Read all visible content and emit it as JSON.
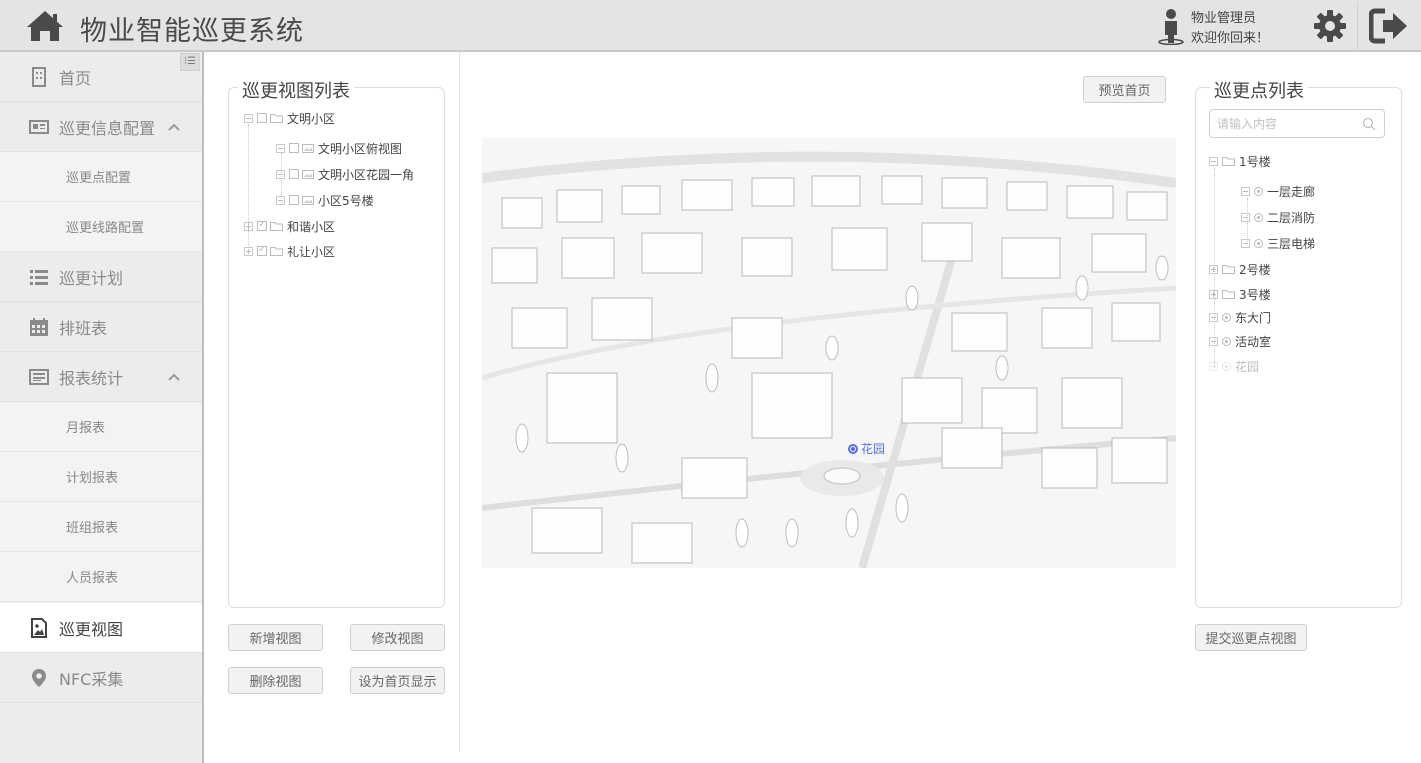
{
  "header": {
    "title": "物业智能巡更系统",
    "user_role": "物业管理员",
    "greeting": "欢迎你回来！",
    "icons": [
      "home-icon",
      "user-icon",
      "gear-icon",
      "logout-icon"
    ]
  },
  "sidebar": {
    "items": [
      {
        "label": "首页",
        "icon": "building-icon"
      },
      {
        "label": "巡更信息配置",
        "icon": "card-icon",
        "expanded": true
      },
      {
        "label": "巡更点配置"
      },
      {
        "label": "巡更线路配置"
      },
      {
        "label": "巡更计划",
        "icon": "list-icon"
      },
      {
        "label": "排班表",
        "icon": "calendar-icon"
      },
      {
        "label": "报表统计",
        "icon": "report-icon",
        "expanded": true
      },
      {
        "label": "月报表"
      },
      {
        "label": "计划报表"
      },
      {
        "label": "班组报表"
      },
      {
        "label": "人员报表"
      },
      {
        "label": "巡更视图",
        "icon": "image-icon",
        "active": true
      },
      {
        "label": "NFC采集",
        "icon": "map-pin-icon"
      }
    ]
  },
  "view_list": {
    "title": "巡更视图列表",
    "tree": [
      {
        "label": "文明小区",
        "children": [
          "文明小区俯视图",
          "文明小区花园一角",
          "小区5号楼"
        ]
      },
      {
        "label": "和谐小区"
      },
      {
        "label": "礼让小区"
      }
    ],
    "buttons": {
      "add": "新增视图",
      "edit": "修改视图",
      "delete": "删除视图",
      "set_home": "设为首页显示"
    }
  },
  "preview": {
    "button": "预览首页",
    "poi_label": "花园"
  },
  "point_list": {
    "title": "巡更点列表",
    "search_placeholder": "请输入内容",
    "tree": [
      {
        "label": "1号楼",
        "children": [
          "一层走廊",
          "二层消防",
          "三层电梯"
        ]
      },
      {
        "label": "2号楼"
      },
      {
        "label": "3号楼"
      },
      {
        "label": "东大门"
      },
      {
        "label": "活动室"
      },
      {
        "label": "花园",
        "disabled": true
      }
    ],
    "submit": "提交巡更点视图"
  },
  "colors": {
    "accent_poi": "#5a72d8",
    "header_bg": "#e4e4e4",
    "sidebar_bg": "#ececec"
  }
}
